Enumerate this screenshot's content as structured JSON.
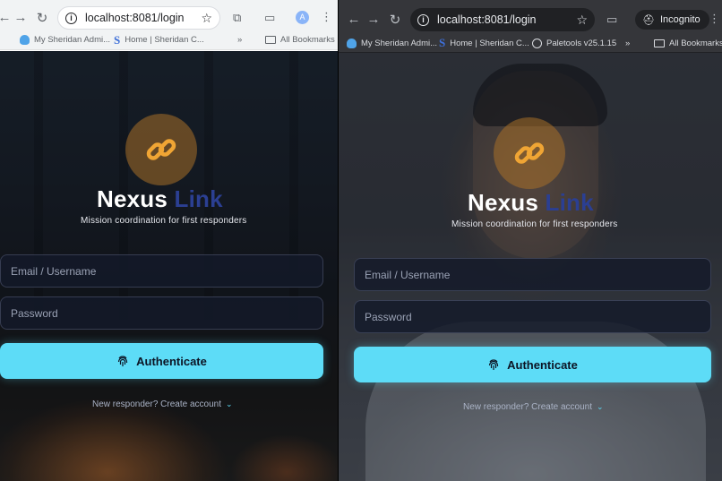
{
  "windows": [
    {
      "url": "localhost:8081/login",
      "profile_initial": "A",
      "bookmarks": [
        "My Sheridan Admi...",
        "Home | Sheridan C...",
        "All Bookmarks"
      ],
      "overflow": "»"
    },
    {
      "url": "localhost:8081/login",
      "incognito_label": "Incognito",
      "bookmarks": [
        "My Sheridan Admi...",
        "Home | Sheridan C...",
        "Paletools v25.1.15",
        "All Bookmarks"
      ],
      "overflow": "»"
    }
  ],
  "app": {
    "title_main": "Nexus",
    "title_accent": "Link",
    "subtitle": "Mission coordination for first responders",
    "email_placeholder": "Email / Username",
    "password_placeholder": "Password",
    "auth_label": "Authenticate",
    "signup_text": "New responder? Create account",
    "signup_chevron": "⌄"
  },
  "colors": {
    "accent_cyan": "#5ddcf7",
    "title_accent": "#2b3f92",
    "logo_gold": "#f0a534"
  },
  "icons": [
    "back-icon",
    "forward-icon",
    "reload-icon",
    "info-icon",
    "star-icon",
    "extensions-icon",
    "cast-icon",
    "menu-icon",
    "incognito-icon",
    "link-chain-icon",
    "fingerprint-icon",
    "cloud-icon",
    "sheridan-s-icon",
    "globe-icon",
    "folder-icon",
    "chevron-down-icon"
  ]
}
